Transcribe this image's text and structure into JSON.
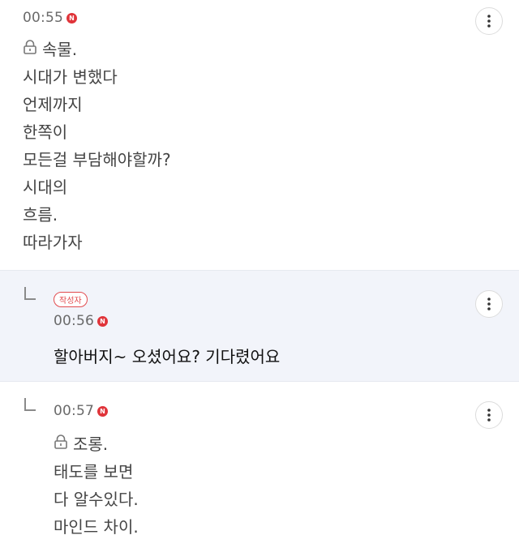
{
  "comments": [
    {
      "time": "00:55",
      "badge": "N",
      "lines": [
        "속물.",
        "시대가 변했다",
        "언제까지",
        "한쪽이",
        "모든걸 부담해야할까?",
        "시대의",
        "흐름.",
        "따라가자"
      ]
    },
    {
      "author_badge": "작성자",
      "time": "00:56",
      "badge": "N",
      "text": "할아버지~ 오셨어요? 기다렸어요"
    },
    {
      "time": "00:57",
      "badge": "N",
      "lines": [
        "조롱.",
        "태도를 보면",
        "다 알수있다.",
        "마인드 차이."
      ]
    }
  ],
  "icons": {
    "lock": "lock-icon",
    "more": "more-vertical-icon",
    "reply": "reply-arrow-icon"
  },
  "colors": {
    "badge_red": "#e0343a",
    "reply_background": "#f2f4fa"
  }
}
